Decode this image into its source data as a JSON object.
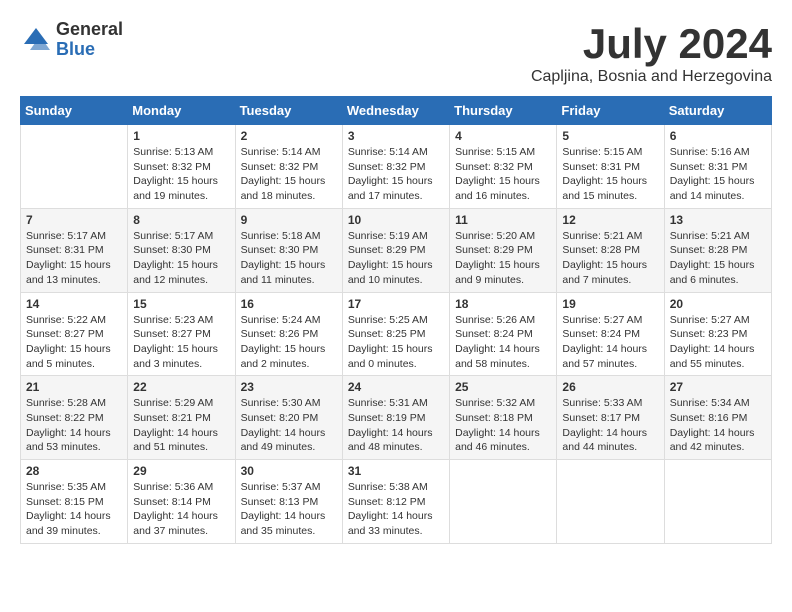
{
  "header": {
    "logo_general": "General",
    "logo_blue": "Blue",
    "month_year": "July 2024",
    "location": "Capljina, Bosnia and Herzegovina"
  },
  "days_of_week": [
    "Sunday",
    "Monday",
    "Tuesday",
    "Wednesday",
    "Thursday",
    "Friday",
    "Saturday"
  ],
  "weeks": [
    [
      {
        "day": "",
        "content": ""
      },
      {
        "day": "1",
        "content": "Sunrise: 5:13 AM\nSunset: 8:32 PM\nDaylight: 15 hours\nand 19 minutes."
      },
      {
        "day": "2",
        "content": "Sunrise: 5:14 AM\nSunset: 8:32 PM\nDaylight: 15 hours\nand 18 minutes."
      },
      {
        "day": "3",
        "content": "Sunrise: 5:14 AM\nSunset: 8:32 PM\nDaylight: 15 hours\nand 17 minutes."
      },
      {
        "day": "4",
        "content": "Sunrise: 5:15 AM\nSunset: 8:32 PM\nDaylight: 15 hours\nand 16 minutes."
      },
      {
        "day": "5",
        "content": "Sunrise: 5:15 AM\nSunset: 8:31 PM\nDaylight: 15 hours\nand 15 minutes."
      },
      {
        "day": "6",
        "content": "Sunrise: 5:16 AM\nSunset: 8:31 PM\nDaylight: 15 hours\nand 14 minutes."
      }
    ],
    [
      {
        "day": "7",
        "content": "Sunrise: 5:17 AM\nSunset: 8:31 PM\nDaylight: 15 hours\nand 13 minutes."
      },
      {
        "day": "8",
        "content": "Sunrise: 5:17 AM\nSunset: 8:30 PM\nDaylight: 15 hours\nand 12 minutes."
      },
      {
        "day": "9",
        "content": "Sunrise: 5:18 AM\nSunset: 8:30 PM\nDaylight: 15 hours\nand 11 minutes."
      },
      {
        "day": "10",
        "content": "Sunrise: 5:19 AM\nSunset: 8:29 PM\nDaylight: 15 hours\nand 10 minutes."
      },
      {
        "day": "11",
        "content": "Sunrise: 5:20 AM\nSunset: 8:29 PM\nDaylight: 15 hours\nand 9 minutes."
      },
      {
        "day": "12",
        "content": "Sunrise: 5:21 AM\nSunset: 8:28 PM\nDaylight: 15 hours\nand 7 minutes."
      },
      {
        "day": "13",
        "content": "Sunrise: 5:21 AM\nSunset: 8:28 PM\nDaylight: 15 hours\nand 6 minutes."
      }
    ],
    [
      {
        "day": "14",
        "content": "Sunrise: 5:22 AM\nSunset: 8:27 PM\nDaylight: 15 hours\nand 5 minutes."
      },
      {
        "day": "15",
        "content": "Sunrise: 5:23 AM\nSunset: 8:27 PM\nDaylight: 15 hours\nand 3 minutes."
      },
      {
        "day": "16",
        "content": "Sunrise: 5:24 AM\nSunset: 8:26 PM\nDaylight: 15 hours\nand 2 minutes."
      },
      {
        "day": "17",
        "content": "Sunrise: 5:25 AM\nSunset: 8:25 PM\nDaylight: 15 hours\nand 0 minutes."
      },
      {
        "day": "18",
        "content": "Sunrise: 5:26 AM\nSunset: 8:24 PM\nDaylight: 14 hours\nand 58 minutes."
      },
      {
        "day": "19",
        "content": "Sunrise: 5:27 AM\nSunset: 8:24 PM\nDaylight: 14 hours\nand 57 minutes."
      },
      {
        "day": "20",
        "content": "Sunrise: 5:27 AM\nSunset: 8:23 PM\nDaylight: 14 hours\nand 55 minutes."
      }
    ],
    [
      {
        "day": "21",
        "content": "Sunrise: 5:28 AM\nSunset: 8:22 PM\nDaylight: 14 hours\nand 53 minutes."
      },
      {
        "day": "22",
        "content": "Sunrise: 5:29 AM\nSunset: 8:21 PM\nDaylight: 14 hours\nand 51 minutes."
      },
      {
        "day": "23",
        "content": "Sunrise: 5:30 AM\nSunset: 8:20 PM\nDaylight: 14 hours\nand 49 minutes."
      },
      {
        "day": "24",
        "content": "Sunrise: 5:31 AM\nSunset: 8:19 PM\nDaylight: 14 hours\nand 48 minutes."
      },
      {
        "day": "25",
        "content": "Sunrise: 5:32 AM\nSunset: 8:18 PM\nDaylight: 14 hours\nand 46 minutes."
      },
      {
        "day": "26",
        "content": "Sunrise: 5:33 AM\nSunset: 8:17 PM\nDaylight: 14 hours\nand 44 minutes."
      },
      {
        "day": "27",
        "content": "Sunrise: 5:34 AM\nSunset: 8:16 PM\nDaylight: 14 hours\nand 42 minutes."
      }
    ],
    [
      {
        "day": "28",
        "content": "Sunrise: 5:35 AM\nSunset: 8:15 PM\nDaylight: 14 hours\nand 39 minutes."
      },
      {
        "day": "29",
        "content": "Sunrise: 5:36 AM\nSunset: 8:14 PM\nDaylight: 14 hours\nand 37 minutes."
      },
      {
        "day": "30",
        "content": "Sunrise: 5:37 AM\nSunset: 8:13 PM\nDaylight: 14 hours\nand 35 minutes."
      },
      {
        "day": "31",
        "content": "Sunrise: 5:38 AM\nSunset: 8:12 PM\nDaylight: 14 hours\nand 33 minutes."
      },
      {
        "day": "",
        "content": ""
      },
      {
        "day": "",
        "content": ""
      },
      {
        "day": "",
        "content": ""
      }
    ]
  ]
}
